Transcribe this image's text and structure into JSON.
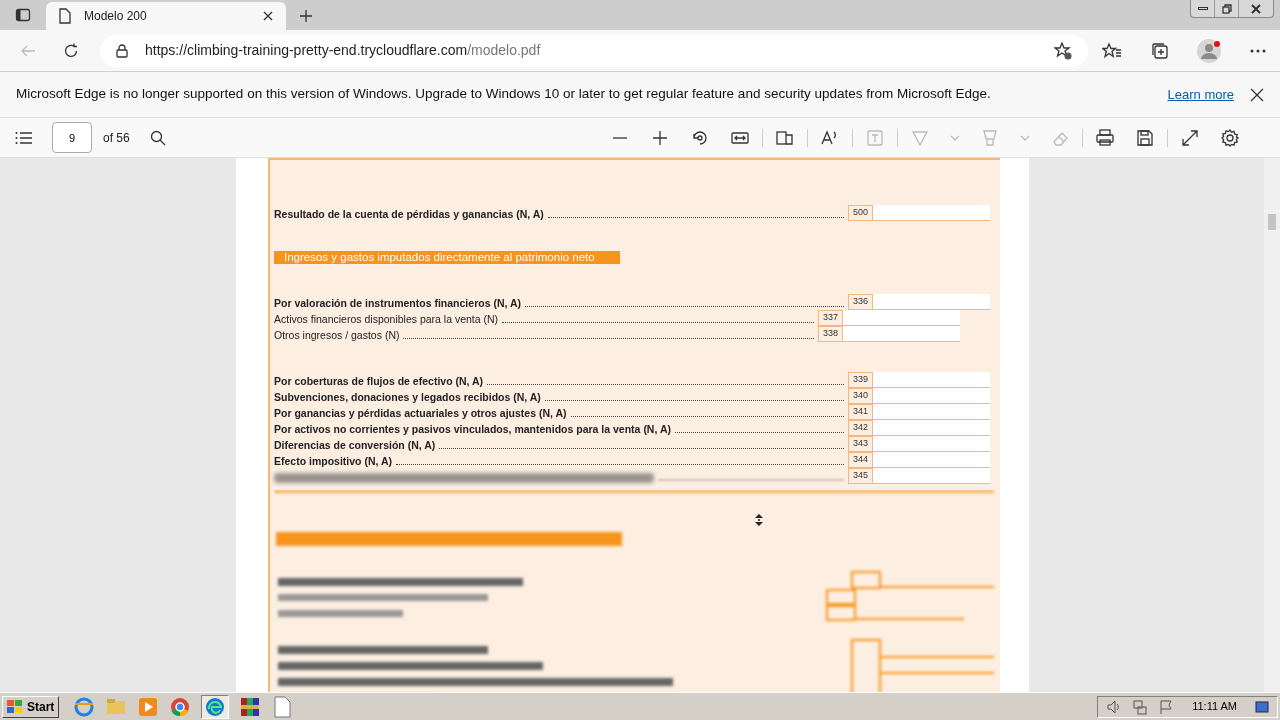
{
  "browser": {
    "tab": {
      "title": "Modelo 200"
    },
    "url": {
      "host": "https://climbing-training-pretty-end.trycloudflare.com",
      "path": "/modelo.pdf"
    }
  },
  "infobar": {
    "message": "Microsoft Edge is no longer supported on this version of Windows. Upgrade to Windows 10 or later to get regular feature and security updates from Microsoft Edge.",
    "link": "Learn more"
  },
  "pdf_toolbar": {
    "page": "9",
    "page_count": "of 56"
  },
  "form": {
    "sections": [
      {
        "rows": [
          {
            "kind": "main",
            "label": "Resultado de la cuenta de pérdidas y ganancias (N, A)",
            "code": "500"
          }
        ]
      },
      {
        "rows": [
          {
            "kind": "heading",
            "label": "Ingresos y gastos imputados directamente al patrimonio neto"
          }
        ]
      },
      {
        "rows": [
          {
            "kind": "main",
            "label": "Por valoración de instrumentos financieros (N, A)",
            "code": "336"
          },
          {
            "kind": "sub",
            "label": "Activos financieros disponibles para la venta (N)",
            "code": "337"
          },
          {
            "kind": "sub",
            "label": "Otros ingresos / gastos (N)",
            "code": "338"
          }
        ]
      },
      {
        "rows": [
          {
            "kind": "main",
            "label": "Por coberturas de flujos de efectivo (N, A)",
            "code": "339"
          },
          {
            "kind": "main",
            "label": "Subvenciones, donaciones y legados recibidos (N, A)",
            "code": "340"
          },
          {
            "kind": "main",
            "label": "Por ganancias y pérdidas actuariales y otros ajustes (N, A)",
            "code": "341"
          },
          {
            "kind": "main",
            "label": "Por activos no corrientes y pasivos vinculados, mantenidos para la venta (N, A)",
            "code": "342"
          },
          {
            "kind": "main",
            "label": "Diferencias de conversión (N, A)",
            "code": "343"
          },
          {
            "kind": "main",
            "label": "Efecto impositivo (N, A)",
            "code": "344"
          },
          {
            "kind": "blurred",
            "code": "345"
          }
        ]
      }
    ]
  },
  "taskbar": {
    "start": "Start",
    "clock": "11:11 AM"
  }
}
